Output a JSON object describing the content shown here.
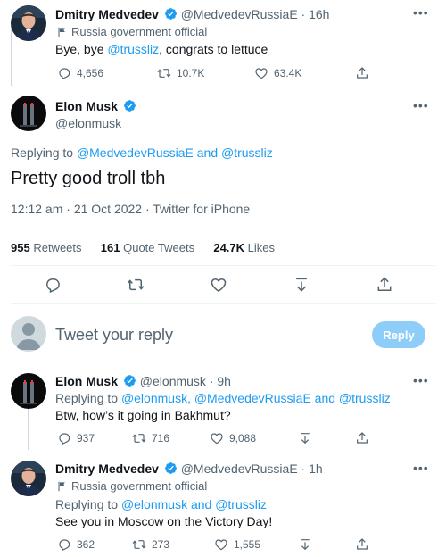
{
  "tweet1": {
    "name": "Dmitry Medvedev",
    "handle": "@MedvedevRussiaE",
    "time": "· 16h",
    "label": "Russia government official",
    "text_pre": "Bye, bye ",
    "mention": "@trussliz",
    "text_post": ", congrats to lettuce",
    "replies": "4,656",
    "retweets": "10.7K",
    "likes": "63.4K"
  },
  "main": {
    "name": "Elon Musk",
    "handle": "@elonmusk",
    "replying_prefix": "Replying to ",
    "replying_to": "@MedvedevRussiaE and @trussliz",
    "text": "Pretty good troll tbh",
    "meta": "12:12 am · 21 Oct 2022 · Twitter for iPhone",
    "retweets_count": "955",
    "retweets_label": "Retweets",
    "quotes_count": "161",
    "quotes_label": "Quote Tweets",
    "likes_count": "24.7K",
    "likes_label": "Likes"
  },
  "composer": {
    "placeholder": "Tweet your reply",
    "button": "Reply"
  },
  "reply1": {
    "name": "Elon Musk",
    "handle": "@elonmusk",
    "time": "· 9h",
    "replying_prefix": "Replying to ",
    "replying_to": "@elonmusk, @MedvedevRussiaE and @trussliz",
    "text": "Btw, how’s it going in Bakhmut?",
    "replies": "937",
    "retweets": "716",
    "likes": "9,088"
  },
  "reply2": {
    "name": "Dmitry Medvedev",
    "handle": "@MedvedevRussiaE",
    "time": "· 1h",
    "label": "Russia government official",
    "replying_prefix": "Replying to ",
    "replying_to": "@elonmusk and @trussliz",
    "text": "See you in Moscow on the Victory Day!",
    "replies": "362",
    "retweets": "273",
    "likes": "1,555"
  },
  "colors": {
    "accent": "#1d9bf0",
    "text": "#0f1419",
    "secondary": "#536471",
    "reply_button": "#8ecdf8"
  }
}
